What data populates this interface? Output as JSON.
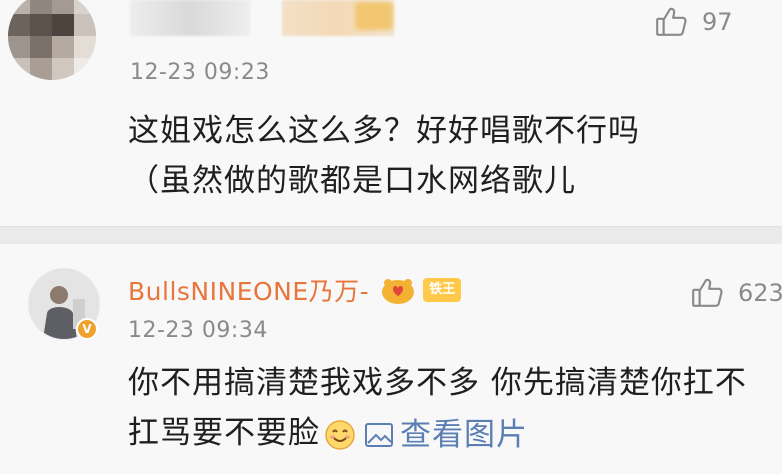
{
  "comments": [
    {
      "timestamp": "12-23 09:23",
      "likes": "97",
      "text_lines": [
        "这姐戏怎么这么多？好好唱歌不行吗",
        "（虽然做的歌都是口水网络歌儿"
      ]
    },
    {
      "username": "BullsNINEONE乃万-",
      "badge": "铁王",
      "verified_mark": "V",
      "timestamp": "12-23 09:34",
      "likes": "623",
      "text_line1": "你不用搞清楚我戏多不多 你先搞清楚你扛不",
      "text_line2": "扛骂要不要脸",
      "pic_link": "查看图片"
    }
  ],
  "colors": {
    "username": "#e8753b",
    "timestamp": "#8a8a8a",
    "link": "#5b7fb5",
    "badge": "#ffc94a"
  },
  "icons": [
    "thumbs-up-icon",
    "smiley-emoji-icon",
    "picture-icon",
    "fan-heart-icon"
  ]
}
